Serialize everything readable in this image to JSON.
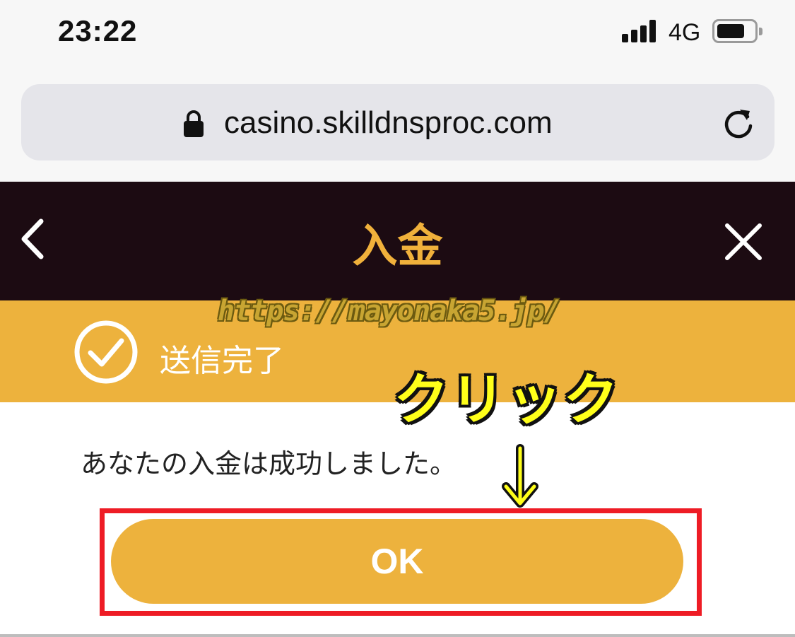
{
  "status_bar": {
    "time": "23:22",
    "network": "4G",
    "battery_level_percent": 80
  },
  "browser": {
    "url": "casino.skilldnsproc.com"
  },
  "header": {
    "title": "入金",
    "back_icon": "chevron-left-icon",
    "close_icon": "close-icon"
  },
  "banner": {
    "text": "送信完了",
    "icon": "check-circle-icon"
  },
  "watermark": {
    "text": "https://mayonaka5.jp/"
  },
  "message": {
    "text": "あなたの入金は成功しました。"
  },
  "annotation": {
    "label": "クリック",
    "arrow_icon": "arrow-down-icon"
  },
  "ok_button": {
    "label": "OK"
  },
  "colors": {
    "header_bg": "#1c0b12",
    "accent": "#edb23d",
    "annotation_yellow": "#ffff1a",
    "highlight_red": "#ee1c25"
  }
}
